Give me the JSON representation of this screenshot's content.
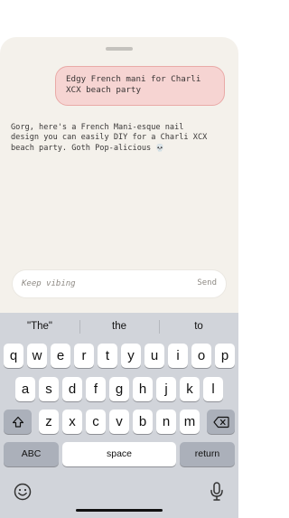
{
  "chat": {
    "user_message_line1": "Edgy French mani for Charli",
    "user_message_line2": "XCX beach party",
    "assistant_line1": "Gorg, here's a French Mani-esque nail",
    "assistant_line2": "design you can easily DIY for a Charli XCX",
    "assistant_line3": "beach party. Goth Pop-alicious",
    "assistant_emoji": "💀"
  },
  "composer": {
    "placeholder": "Keep vibing",
    "send_label": "Send"
  },
  "keyboard": {
    "suggestions": [
      "\"The\"",
      "the",
      "to"
    ],
    "row1": [
      "q",
      "w",
      "e",
      "r",
      "t",
      "y",
      "u",
      "i",
      "o",
      "p"
    ],
    "row2": [
      "a",
      "s",
      "d",
      "f",
      "g",
      "h",
      "j",
      "k",
      "l"
    ],
    "row3": [
      "z",
      "x",
      "c",
      "v",
      "b",
      "n",
      "m"
    ],
    "abc_label": "ABC",
    "space_label": "space",
    "return_label": "return",
    "icons": {
      "shift": "shift-icon",
      "delete": "backspace-icon",
      "emoji": "emoji-icon",
      "mic": "microphone-icon"
    }
  },
  "colors": {
    "sheet_bg": "#f4f1eb",
    "user_bubble_bg": "#f6d4d2",
    "user_bubble_border": "#e9aaa7",
    "keyboard_bg": "#d1d4da"
  }
}
